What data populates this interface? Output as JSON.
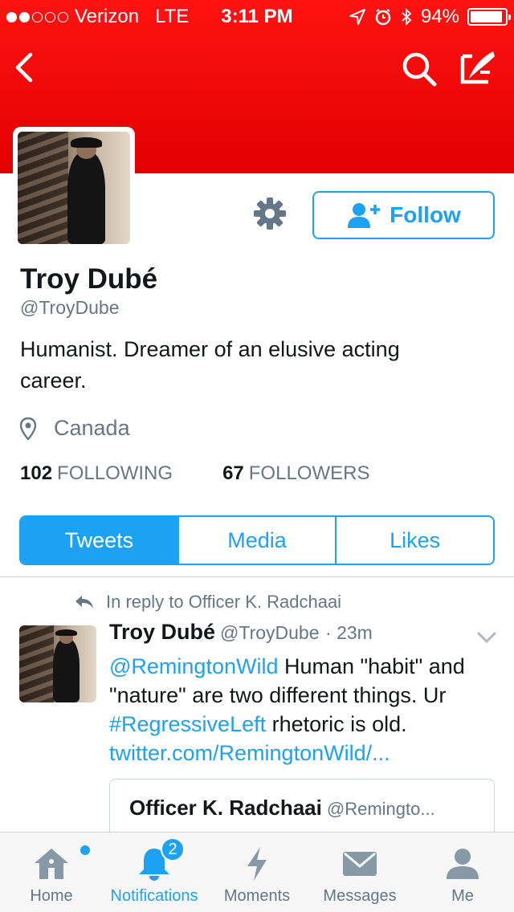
{
  "status_bar": {
    "carrier": "Verizon",
    "network": "LTE",
    "time": "3:11 PM",
    "battery": "94%",
    "battery_level": 0.94
  },
  "profile": {
    "name": "Troy Dubé",
    "handle": "@TroyDube",
    "bio": "Humanist. Dreamer of an elusive acting career.",
    "location": "Canada",
    "following_count": "102",
    "following_label": "FOLLOWING",
    "followers_count": "67",
    "followers_label": "FOLLOWERS",
    "follow_label": "Follow"
  },
  "segments": [
    "Tweets",
    "Media",
    "Likes"
  ],
  "tweet": {
    "reply_context": "In reply to Officer K. Radchaai",
    "author_name": "Troy Dubé",
    "author_handle": "@TroyDube",
    "time": "· 23m",
    "mention": "@RemingtonWild",
    "text_1": " Human \"habit\" and \"nature\" are two different things. Ur ",
    "hashtag": "#RegressiveLeft",
    "text_2": " rhetoric is old. ",
    "link": "twitter.com/RemingtonWild/...",
    "quote_name": "Officer K. Radchaai",
    "quote_handle": "@Remingto..."
  },
  "tabbar": {
    "home": "Home",
    "notifications": "Notifications",
    "notifications_badge": "2",
    "moments": "Moments",
    "messages": "Messages",
    "me": "Me"
  },
  "colors": {
    "header_red": "#e60000",
    "accent_blue": "#1da1f2",
    "muted_gray": "#657786"
  }
}
